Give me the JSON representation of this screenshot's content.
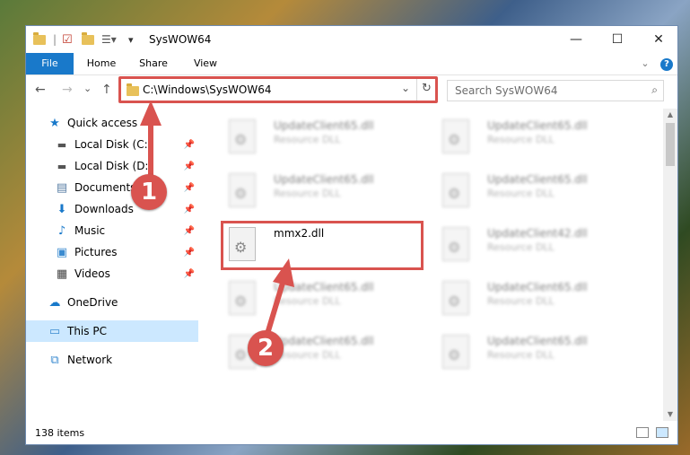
{
  "window": {
    "title": "SysWOW64",
    "controls": {
      "minimize": "—",
      "maximize": "☐",
      "close": "✕"
    }
  },
  "ribbon": {
    "tabs": [
      "File",
      "Home",
      "Share",
      "View"
    ],
    "collapse": "⌄",
    "help": "?"
  },
  "nav": {
    "back": "←",
    "forward": "→",
    "recent": "⌄",
    "up": "↑",
    "address": "C:\\Windows\\SysWOW64",
    "address_dropdown": "⌄",
    "refresh": "↻",
    "search_placeholder": "Search SysWOW64"
  },
  "sidebar": {
    "items": [
      {
        "label": "Quick access",
        "icon": "star-icon",
        "pinned": false
      },
      {
        "label": "Local Disk (C:)",
        "icon": "drive-icon",
        "pinned": true
      },
      {
        "label": "Local Disk (D:)",
        "icon": "drive-icon",
        "pinned": true
      },
      {
        "label": "Documents",
        "icon": "documents-icon",
        "pinned": true
      },
      {
        "label": "Downloads",
        "icon": "download-icon",
        "pinned": true
      },
      {
        "label": "Music",
        "icon": "music-icon",
        "pinned": true
      },
      {
        "label": "Pictures",
        "icon": "pictures-icon",
        "pinned": true
      },
      {
        "label": "Videos",
        "icon": "videos-icon",
        "pinned": true
      },
      {
        "label": "OneDrive",
        "icon": "cloud-icon",
        "pinned": false
      },
      {
        "label": "This PC",
        "icon": "computer-icon",
        "pinned": false,
        "selected": true
      },
      {
        "label": "Network",
        "icon": "network-icon",
        "pinned": false
      }
    ],
    "pin_glyph": "📌"
  },
  "files": [
    {
      "name": "UpdateClient65.dll",
      "type": "Resource DLL",
      "blurred": true
    },
    {
      "name": "UpdateClient65.dll",
      "type": "Resource DLL",
      "blurred": true
    },
    {
      "name": "UpdateClient65.dll",
      "type": "Resource DLL",
      "blurred": true
    },
    {
      "name": "UpdateClient65.dll",
      "type": "Resource DLL",
      "blurred": true
    },
    {
      "name": "mmx2.dll",
      "type": "",
      "blurred": false
    },
    {
      "name": "UpdateClient42.dll",
      "type": "Resource DLL",
      "blurred": true
    },
    {
      "name": "UpdateClient65.dll",
      "type": "Resource DLL",
      "blurred": true
    },
    {
      "name": "UpdateClient65.dll",
      "type": "Resource DLL",
      "blurred": true
    },
    {
      "name": "UpdateClient65.dll",
      "type": "Resource DLL",
      "blurred": true
    },
    {
      "name": "UpdateClient65.dll",
      "type": "Resource DLL",
      "blurred": true
    }
  ],
  "status": {
    "item_count": "138 items"
  },
  "annotations": {
    "step1": "1",
    "step2": "2",
    "color": "#d9534f"
  }
}
